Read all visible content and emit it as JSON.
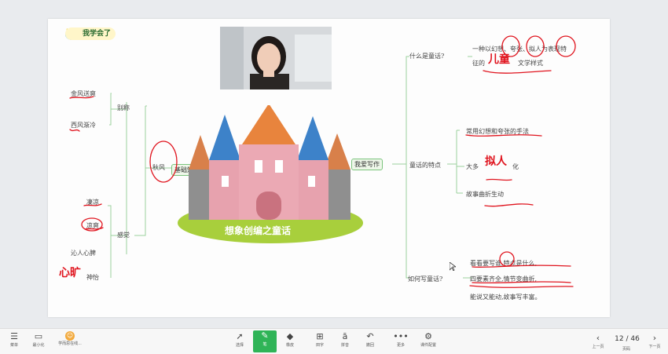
{
  "badge": {
    "label": "我学会了"
  },
  "mindmap": {
    "center_title": "想象创编之童话",
    "left": {
      "main_label": "基础知识",
      "sub1": "秋风",
      "sub1_children": [
        "别称",
        "感觉"
      ],
      "biecheng": [
        "金风送爽",
        "西风渐冷"
      ],
      "ganjue": [
        "凄凉",
        "凉爽",
        "沁人心脾",
        "神怡"
      ],
      "hand_note": "心旷"
    },
    "right": {
      "main_label": "我爱写作",
      "q1": {
        "label": "什么是童话?",
        "text_line1": "一种以幻想、夸张、拟人为表现特",
        "text_line2": "征的",
        "text_line2_end": "文学样式",
        "hand_note": "儿童"
      },
      "q2": {
        "label": "童话的特点",
        "items": [
          "常用幻想和夸张的手法",
          "大多",
          "化",
          "故事曲折生动"
        ],
        "hand_note": "拟人"
      },
      "q3": {
        "label": "如何写童话?",
        "lines": [
          "看看要写谁,特点是什么,",
          "四要素齐全,情节变曲折,",
          "能说又能动,故事写丰富。"
        ]
      }
    }
  },
  "toolbar": {
    "left": [
      {
        "icon": "menu-icon",
        "label": "菜单"
      },
      {
        "icon": "minimize-icon",
        "label": "最小化"
      },
      {
        "icon": "avatar-icon",
        "label": "学而思在线..."
      }
    ],
    "center": [
      {
        "icon": "cursor-icon",
        "label": "选择"
      },
      {
        "icon": "pen-icon",
        "label": "笔"
      },
      {
        "icon": "eraser-icon",
        "label": "橡皮"
      },
      {
        "icon": "grid-icon",
        "label": "田字"
      },
      {
        "icon": "pinyin-icon",
        "label": "拼音"
      },
      {
        "icon": "undo-icon",
        "label": "撤回"
      },
      {
        "icon": "more-icon",
        "label": "更多"
      },
      {
        "icon": "courseware-icon",
        "label": "课件配置"
      }
    ],
    "pager": {
      "prev": "上一页",
      "page": "12 / 46",
      "pages_label": "页码",
      "next": "下一页"
    }
  },
  "colors": {
    "accent": "#2fb457",
    "hand": "#e0141e",
    "branch": "#7cc47e"
  }
}
